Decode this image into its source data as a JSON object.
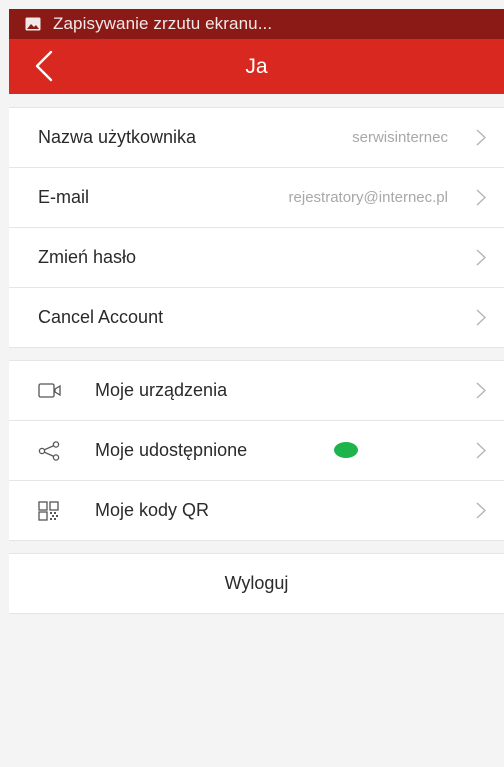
{
  "statusbar": {
    "text": "Zapisywanie zrzutu ekranu...",
    "icon": "image-icon"
  },
  "appbar": {
    "title": "Ja",
    "back_icon": "chevron-left-icon"
  },
  "account": {
    "items": [
      {
        "label": "Nazwa użytkownika",
        "value": "serwisinternec"
      },
      {
        "label": "E-mail",
        "value": "rejestratory@internec.pl"
      },
      {
        "label": "Zmień hasło",
        "value": ""
      },
      {
        "label": "Cancel Account",
        "value": ""
      }
    ]
  },
  "devices": {
    "items": [
      {
        "label": "Moje urządzenia",
        "icon": "video-camera-icon"
      },
      {
        "label": "Moje udostępnione",
        "icon": "share-icon",
        "badge_color": "#1db44b"
      },
      {
        "label": "Moje kody QR",
        "icon": "qr-code-icon"
      }
    ]
  },
  "logout": {
    "label": "Wyloguj"
  },
  "colors": {
    "accent": "#d8281f",
    "statusbar": "#8b1a17",
    "badge": "#1db44b"
  }
}
